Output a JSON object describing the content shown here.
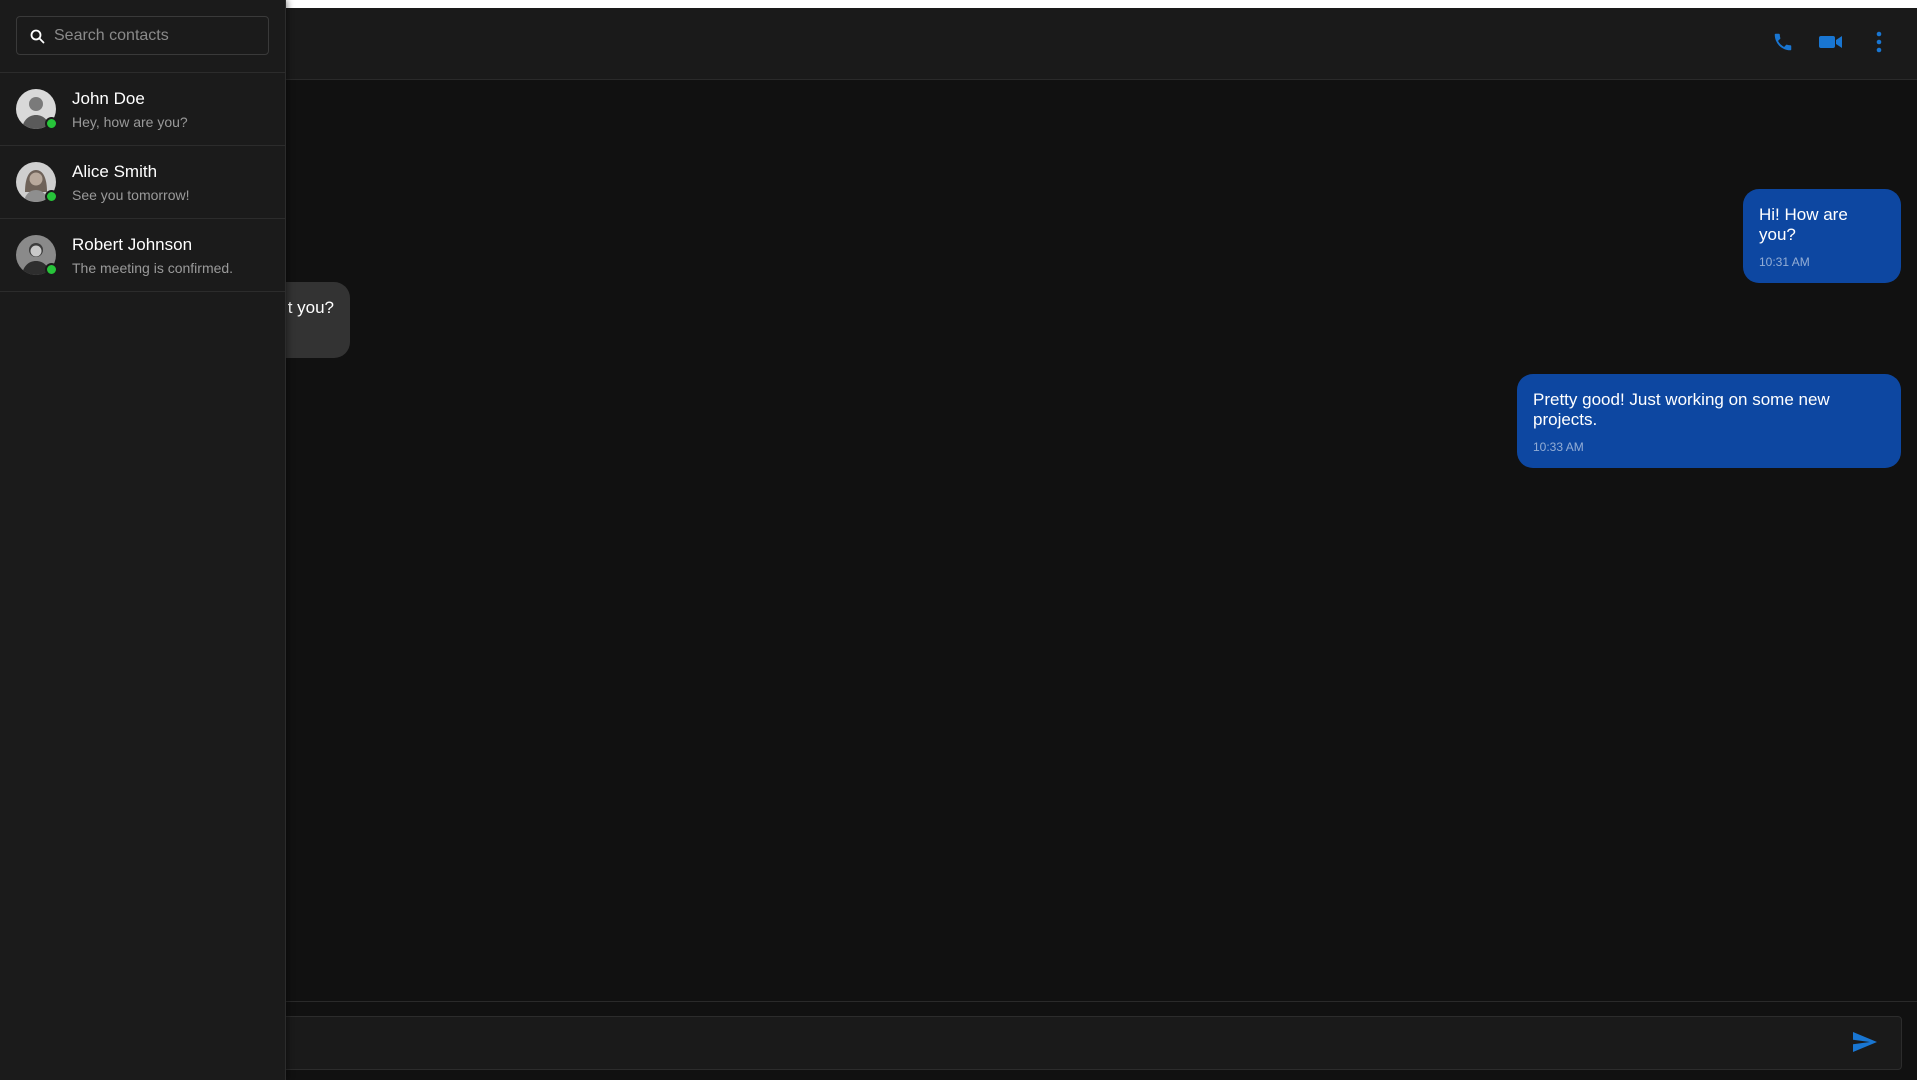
{
  "colors": {
    "accent": "#1976d2",
    "outgoing_bubble": "#0d47a1",
    "incoming_bubble": "#333333",
    "online": "#27c43a",
    "background": "#111111",
    "panel": "#1b1b1b"
  },
  "sidebar": {
    "search": {
      "placeholder": "Search contacts",
      "value": "",
      "icon": "search-icon"
    },
    "contacts": [
      {
        "name": "John Doe",
        "preview": "Hey, how are you?",
        "status": "online"
      },
      {
        "name": "Alice Smith",
        "preview": "See you tomorrow!",
        "status": "online"
      },
      {
        "name": "Robert Johnson",
        "preview": "The meeting is confirmed.",
        "status": "online"
      }
    ]
  },
  "header": {
    "actions": [
      {
        "name": "call",
        "icon": "phone-icon"
      },
      {
        "name": "video",
        "icon": "video-camera-icon"
      },
      {
        "name": "more",
        "icon": "more-vertical-icon"
      }
    ]
  },
  "messages": [
    {
      "direction": "outgoing",
      "text": "Hi! How are you?",
      "time": "10:31 AM"
    },
    {
      "direction": "incoming",
      "text": "t you?",
      "time": ""
    },
    {
      "direction": "outgoing",
      "text": "Pretty good! Just working on some new projects.",
      "time": "10:33 AM"
    }
  ],
  "composer": {
    "placeholder": "",
    "value": "",
    "send_icon": "send-icon"
  }
}
